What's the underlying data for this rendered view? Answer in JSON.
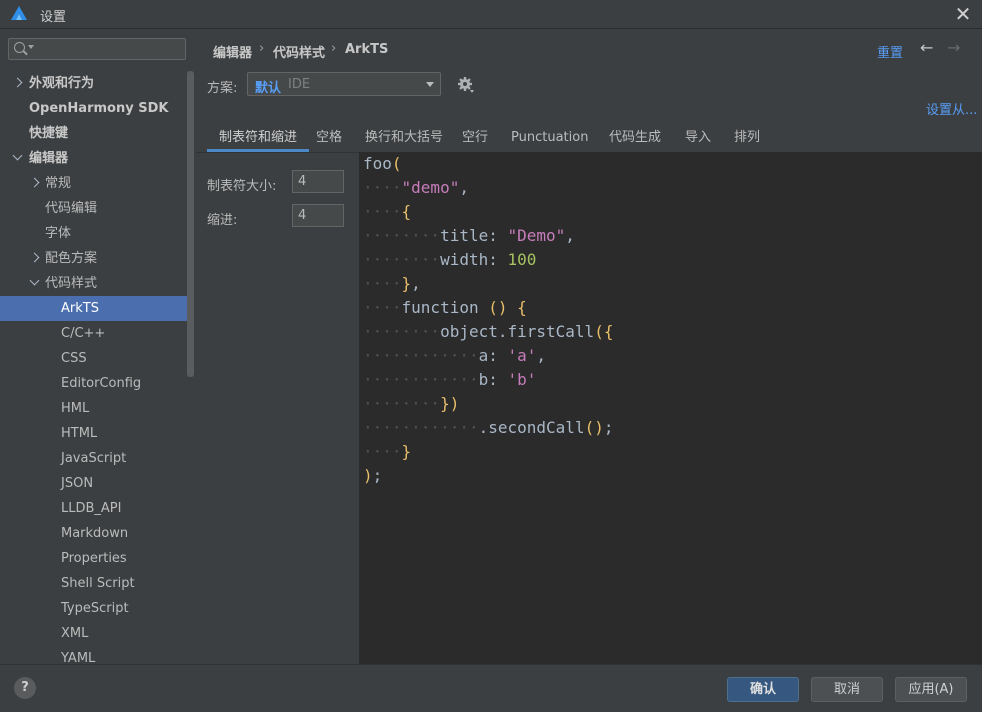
{
  "window": {
    "title": "设置",
    "close_glyph": "✕"
  },
  "search": {
    "placeholder": "",
    "value": ""
  },
  "sidebar": {
    "items": [
      {
        "label": "外观和行为",
        "arrow": "right",
        "level": 0,
        "bold": true
      },
      {
        "label": "OpenHarmony SDK",
        "arrow": "",
        "level": 0,
        "bold": true
      },
      {
        "label": "快捷键",
        "arrow": "",
        "level": 0,
        "bold": true
      },
      {
        "label": "编辑器",
        "arrow": "down",
        "level": 0,
        "bold": true
      },
      {
        "label": "常规",
        "arrow": "right",
        "level": 1
      },
      {
        "label": "代码编辑",
        "arrow": "",
        "level": 1
      },
      {
        "label": "字体",
        "arrow": "",
        "level": 1
      },
      {
        "label": "配色方案",
        "arrow": "right",
        "level": 1
      },
      {
        "label": "代码样式",
        "arrow": "down",
        "level": 1
      },
      {
        "label": "ArkTS",
        "arrow": "",
        "level": 2,
        "selected": true
      },
      {
        "label": "C/C++",
        "arrow": "",
        "level": 2
      },
      {
        "label": "CSS",
        "arrow": "",
        "level": 2
      },
      {
        "label": "EditorConfig",
        "arrow": "",
        "level": 2
      },
      {
        "label": "HML",
        "arrow": "",
        "level": 2
      },
      {
        "label": "HTML",
        "arrow": "",
        "level": 2
      },
      {
        "label": "JavaScript",
        "arrow": "",
        "level": 2
      },
      {
        "label": "JSON",
        "arrow": "",
        "level": 2
      },
      {
        "label": "LLDB_API",
        "arrow": "",
        "level": 2
      },
      {
        "label": "Markdown",
        "arrow": "",
        "level": 2
      },
      {
        "label": "Properties",
        "arrow": "",
        "level": 2
      },
      {
        "label": "Shell Script",
        "arrow": "",
        "level": 2
      },
      {
        "label": "TypeScript",
        "arrow": "",
        "level": 2
      },
      {
        "label": "XML",
        "arrow": "",
        "level": 2
      },
      {
        "label": "YAML",
        "arrow": "",
        "level": 2
      }
    ]
  },
  "breadcrumb": {
    "items": [
      "编辑器",
      "代码样式",
      "ArkTS"
    ],
    "separator": "›"
  },
  "header": {
    "reset_label": "重置",
    "back_glyph": "←",
    "forward_glyph": "→"
  },
  "scheme": {
    "label": "方案:",
    "name": "默认",
    "type": "IDE",
    "set_from_label": "设置从..."
  },
  "tabs": [
    {
      "label": "制表符和缩进",
      "active": true
    },
    {
      "label": "空格"
    },
    {
      "label": "换行和大括号"
    },
    {
      "label": "空行"
    },
    {
      "label": "Punctuation"
    },
    {
      "label": "代码生成"
    },
    {
      "label": "导入"
    },
    {
      "label": "排列"
    }
  ],
  "options": {
    "tab_size_label": "制表符大小:",
    "tab_size_value": "4",
    "indent_label": "缩进:",
    "indent_value": "4"
  },
  "code": {
    "lines": [
      [
        [
          "plain",
          "foo"
        ],
        [
          "paren",
          "("
        ]
      ],
      [
        [
          "ws",
          "····"
        ],
        [
          "str",
          "\"demo\""
        ],
        [
          "plain",
          ","
        ]
      ],
      [
        [
          "ws",
          "····"
        ],
        [
          "paren",
          "{"
        ]
      ],
      [
        [
          "ws",
          "········"
        ],
        [
          "plain",
          "title: "
        ],
        [
          "str",
          "\"Demo\""
        ],
        [
          "plain",
          ","
        ]
      ],
      [
        [
          "ws",
          "········"
        ],
        [
          "plain",
          "width: "
        ],
        [
          "num",
          "100"
        ]
      ],
      [
        [
          "ws",
          "····"
        ],
        [
          "paren",
          "}"
        ],
        [
          "plain",
          ","
        ]
      ],
      [
        [
          "ws",
          "····"
        ],
        [
          "plain",
          "function "
        ],
        [
          "paren",
          "()"
        ],
        [
          "plain",
          " "
        ],
        [
          "paren",
          "{"
        ]
      ],
      [
        [
          "ws",
          "········"
        ],
        [
          "plain",
          "object.firstCall"
        ],
        [
          "paren",
          "({"
        ]
      ],
      [
        [
          "ws",
          "············"
        ],
        [
          "plain",
          "a: "
        ],
        [
          "str",
          "'a'"
        ],
        [
          "plain",
          ","
        ]
      ],
      [
        [
          "ws",
          "············"
        ],
        [
          "plain",
          "b: "
        ],
        [
          "str",
          "'b'"
        ]
      ],
      [
        [
          "ws",
          "········"
        ],
        [
          "paren",
          "})"
        ]
      ],
      [
        [
          "ws",
          "············"
        ],
        [
          "plain",
          ".secondCall"
        ],
        [
          "paren",
          "()"
        ],
        [
          "plain",
          ";"
        ]
      ],
      [
        [
          "ws",
          "····"
        ],
        [
          "paren",
          "}"
        ]
      ],
      [
        [
          "paren",
          ")"
        ],
        [
          "plain",
          ";"
        ]
      ]
    ]
  },
  "footer": {
    "help_label": "?",
    "ok_label": "确认",
    "cancel_label": "取消",
    "apply_label": "应用(A)"
  }
}
